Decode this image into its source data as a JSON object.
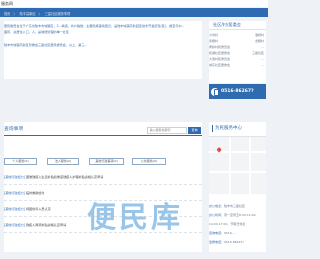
{
  "header": {
    "site_title": "服务网"
  },
  "breadcrumb": {
    "items": [
      "首页",
      "〉",
      "陆丰高新区",
      "〉",
      "三星社区服务事项"
    ]
  },
  "intro": {
    "lines": [
      "居民委员会位于广东省陆丰市城镇区，2...精选，共户籍数，主要民族事情登记，是陆丰城镇高新园区技术开发区辖(区)，截至与中...",
      "面积，总居住人口，人，是城陆管理的单一社区",
      "",
      "陆丰市城镇高新区管委会三星社区居民委员会，以上，第三..."
    ]
  },
  "community": {
    "title": "社区/村/居委会",
    "rows": [
      {
        "left": "沙坊村",
        "right": "港桥村"
      },
      {
        "left": "凤栖村",
        "right": "龙翔村"
      },
      {
        "left": "黄岭村民委员会",
        "right": "..."
      },
      {
        "left": "和湖社区居委会",
        "right": "三星社区"
      },
      {
        "left": "大康村民委员会",
        "right": "..."
      },
      {
        "left": "城东社区居委会",
        "right": "..."
      }
    ]
  },
  "hotline": {
    "number": "0516-86267?"
  },
  "query": {
    "title": "查询事项",
    "search": {
      "placeholder": "输入搜索关键字"
    },
    "search_button": "查询",
    "tabs": [
      "个人服务(0)",
      "法人服务(2)",
      "其他行政事项(0)",
      "公共服务(0)"
    ]
  },
  "items": [
    {
      "category": "[其他行政权力]",
      "title": "困难残疾人生活补贴和重度残疾人护理补贴资格认定申请"
    },
    {
      "category": "[其他行政权力]",
      "title": "临时救助给付"
    },
    {
      "category": "[其他行政权力]",
      "title": "特困供养人员认定"
    },
    {
      "category": "[其他行政权力]",
      "title": "残疾人两项补贴资格认定申请"
    }
  ],
  "service_center": {
    "title": "为民服务中心",
    "info": [
      {
        "key": "办公地点：",
        "value": "陆丰市三星社区"
      },
      {
        "key": "办公时间：",
        "value": "周一至周五8:30-12:00"
      },
      {
        "key": "",
        "value": "14:00-17:00，节假日休息"
      },
      {
        "key": "咨询电话：",
        "value": "0516-…"
      },
      {
        "key": "监督电话：",
        "value": "0516-86267?"
      }
    ]
  },
  "watermark": {
    "text": "便民库"
  }
}
